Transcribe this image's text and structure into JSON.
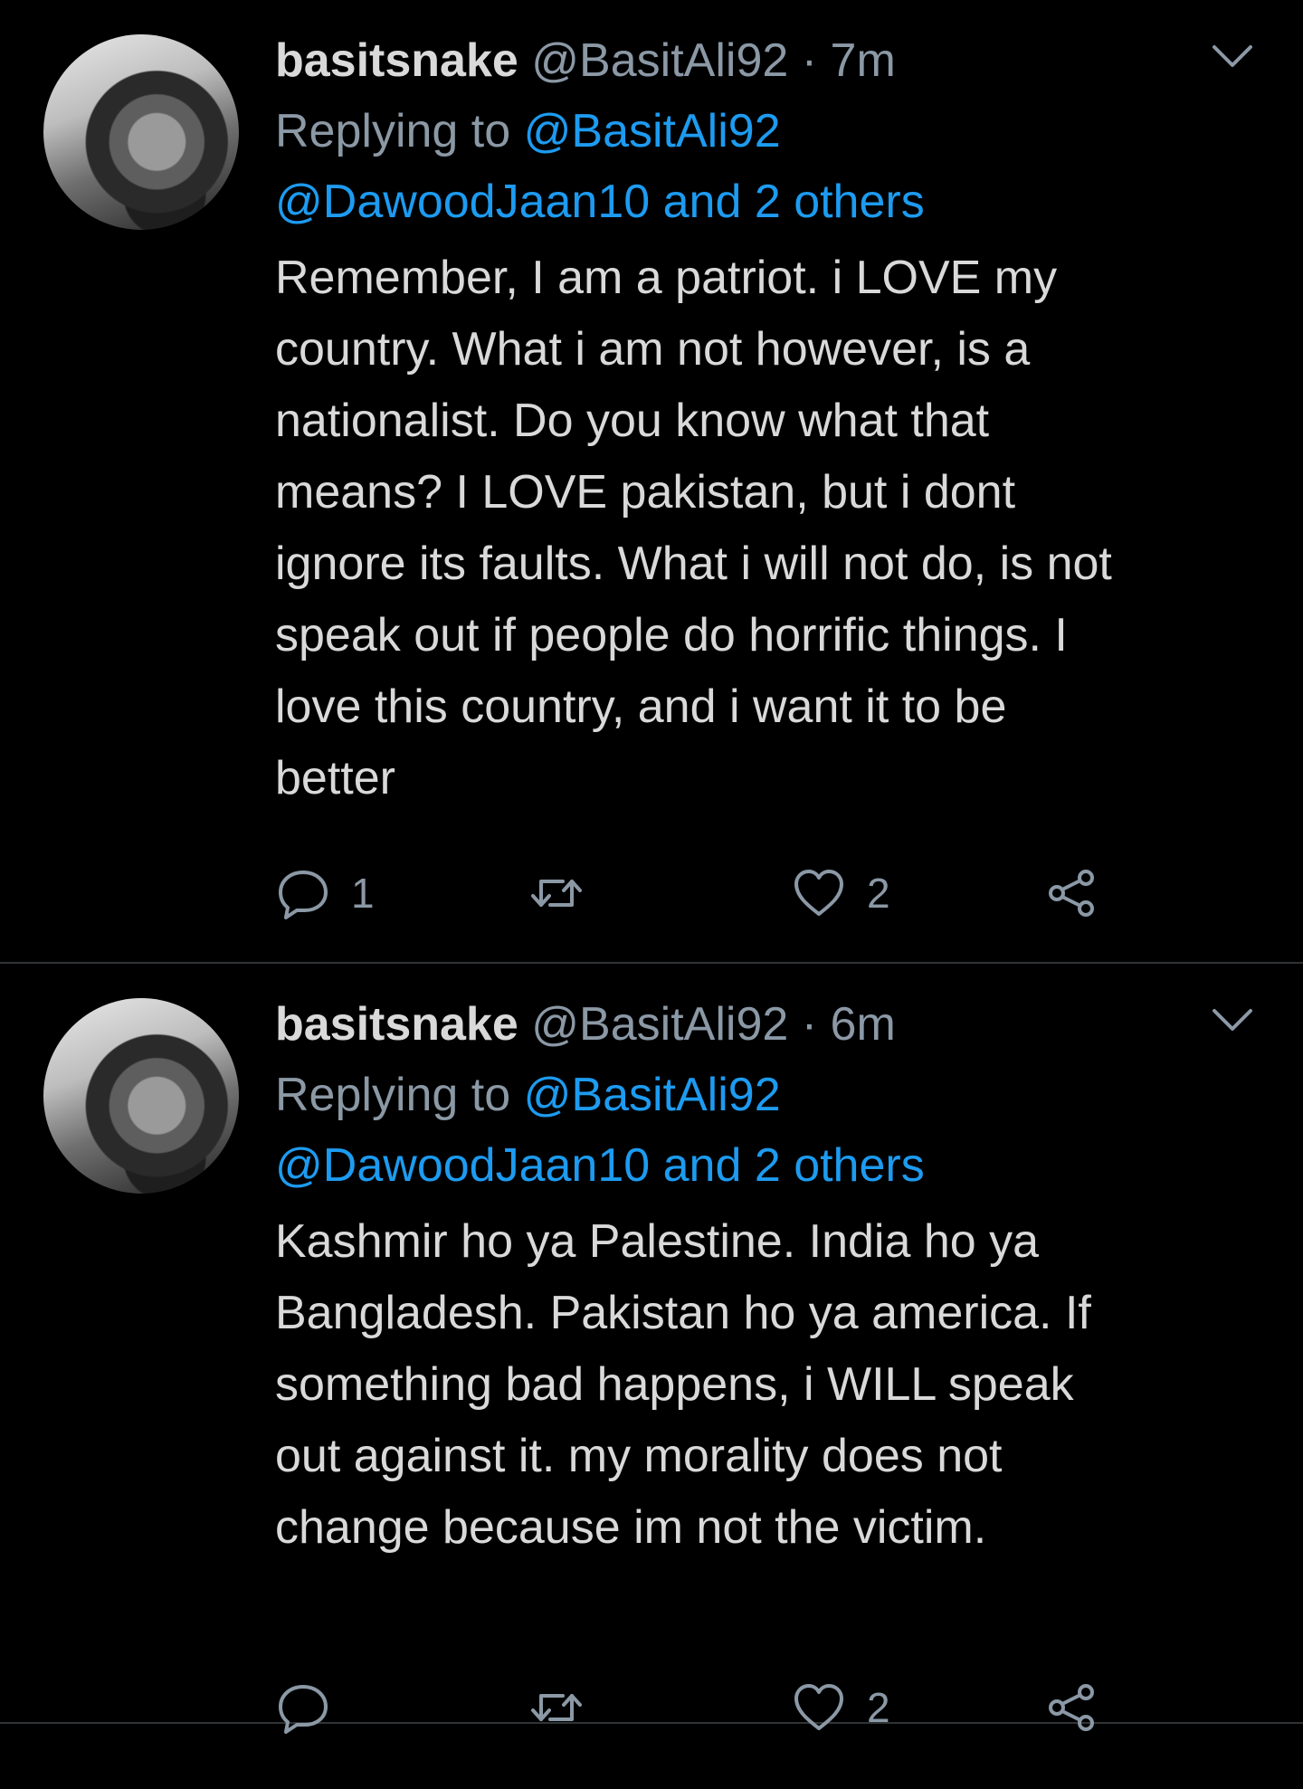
{
  "colors": {
    "background": "#000000",
    "text": "#d9d9d9",
    "muted": "#8b98a5",
    "link": "#1d9bf0",
    "divider": "#2f3336"
  },
  "tweets": [
    {
      "display_name": "basitsnake",
      "handle": "@BasitAli92",
      "separator": "·",
      "time": "7m",
      "replying_prefix": "Replying to",
      "replying_handle": "@BasitAli92",
      "replying_others": "@DawoodJaan10 and 2 others",
      "body_lines": [
        "Remember, I am a patriot. i LOVE my",
        "country. What i am not however, is a",
        "nationalist. Do you know what that",
        "means? I LOVE pakistan, but i dont",
        "ignore its faults. What i will not do, is not",
        "speak out if people do horrific things.  I",
        "love this country, and i want it to be",
        "better"
      ],
      "reply_count": "1",
      "retweet_count": "",
      "like_count": "2",
      "icons": [
        "reply-icon",
        "retweet-icon",
        "like-icon",
        "share-icon",
        "chevron-down-icon"
      ]
    },
    {
      "display_name": "basitsnake",
      "handle": "@BasitAli92",
      "separator": "·",
      "time": "6m",
      "replying_prefix": "Replying to",
      "replying_handle": "@BasitAli92",
      "replying_others": "@DawoodJaan10 and 2 others",
      "body_lines": [
        "Kashmir ho ya Palestine. India ho ya",
        "Bangladesh. Pakistan ho ya america. If",
        "something bad happens, i WILL speak",
        "out against it. my morality does not",
        "change because im not the victim."
      ],
      "reply_count": "",
      "retweet_count": "",
      "like_count": "2",
      "icons": [
        "reply-icon",
        "retweet-icon",
        "like-icon",
        "share-icon",
        "chevron-down-icon"
      ]
    }
  ]
}
